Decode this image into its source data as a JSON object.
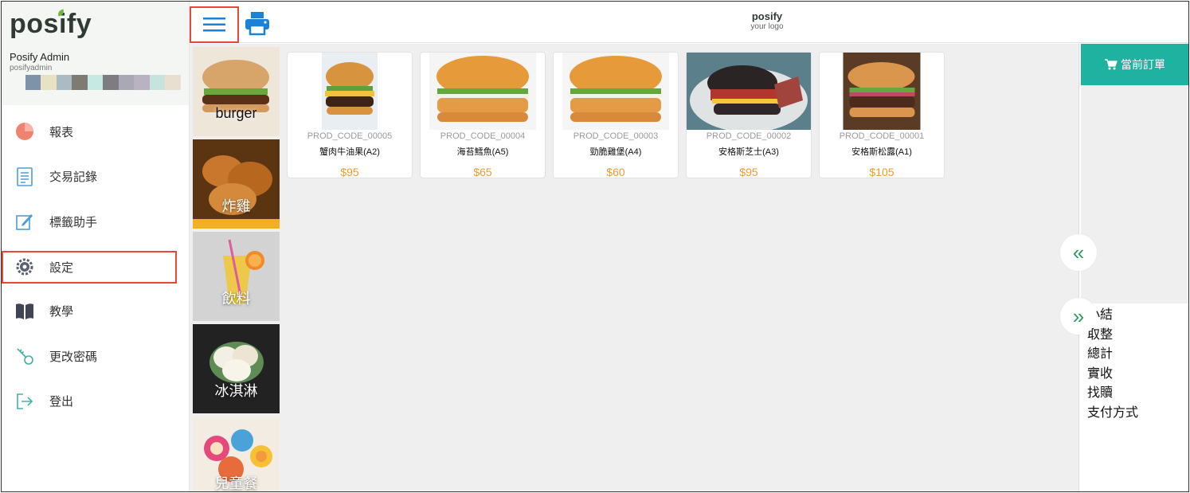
{
  "sidebar": {
    "logo": "posify",
    "admin_name": "Posify Admin",
    "admin_user": "posifyadmin",
    "swatch_colors": [
      "#f4f6f4",
      "#7e93a8",
      "#e9e2c2",
      "#a9bcc4",
      "#7d7b72",
      "#c7e9e4",
      "#7e7c80",
      "#a9a9b6",
      "#b9b2c0",
      "#c6e3dd",
      "#e8dfd0",
      "#e3eee9"
    ],
    "items": [
      {
        "label": "報表",
        "icon": "pie-chart-icon"
      },
      {
        "label": "交易記錄",
        "icon": "document-list-icon"
      },
      {
        "label": "標籤助手",
        "icon": "edit-square-icon"
      },
      {
        "label": "設定",
        "icon": "gear-icon"
      },
      {
        "label": "教學",
        "icon": "book-icon"
      },
      {
        "label": "更改密碼",
        "icon": "key-icon"
      },
      {
        "label": "登出",
        "icon": "logout-icon"
      }
    ]
  },
  "topbar": {
    "brand_name": "posify",
    "brand_sub": "your logo"
  },
  "categories": [
    {
      "label": "burger"
    },
    {
      "label": "炸雞"
    },
    {
      "label": "飲料"
    },
    {
      "label": "冰淇淋"
    },
    {
      "label": "兒童餐"
    }
  ],
  "products": [
    {
      "code": "PROD_CODE_00005",
      "name": "蟹肉牛油果(A2)",
      "price": "$95"
    },
    {
      "code": "PROD_CODE_00004",
      "name": "海苔鱈魚(A5)",
      "price": "$65"
    },
    {
      "code": "PROD_CODE_00003",
      "name": "勁脆雞堡(A4)",
      "price": "$60"
    },
    {
      "code": "PROD_CODE_00002",
      "name": "安格斯芝士(A3)",
      "price": "$95"
    },
    {
      "code": "PROD_CODE_00001",
      "name": "安格斯松露(A1)",
      "price": "$105"
    }
  ],
  "right_panel": {
    "order_label": "當前訂單",
    "summary": [
      "小結",
      "取整",
      "總計",
      "實收",
      "找贖",
      "支付方式"
    ]
  },
  "colors": {
    "accent_teal": "#1fb2a0",
    "price_orange": "#f39a2e",
    "highlight_red": "#e8473a",
    "icon_blue": "#1b82d6"
  }
}
